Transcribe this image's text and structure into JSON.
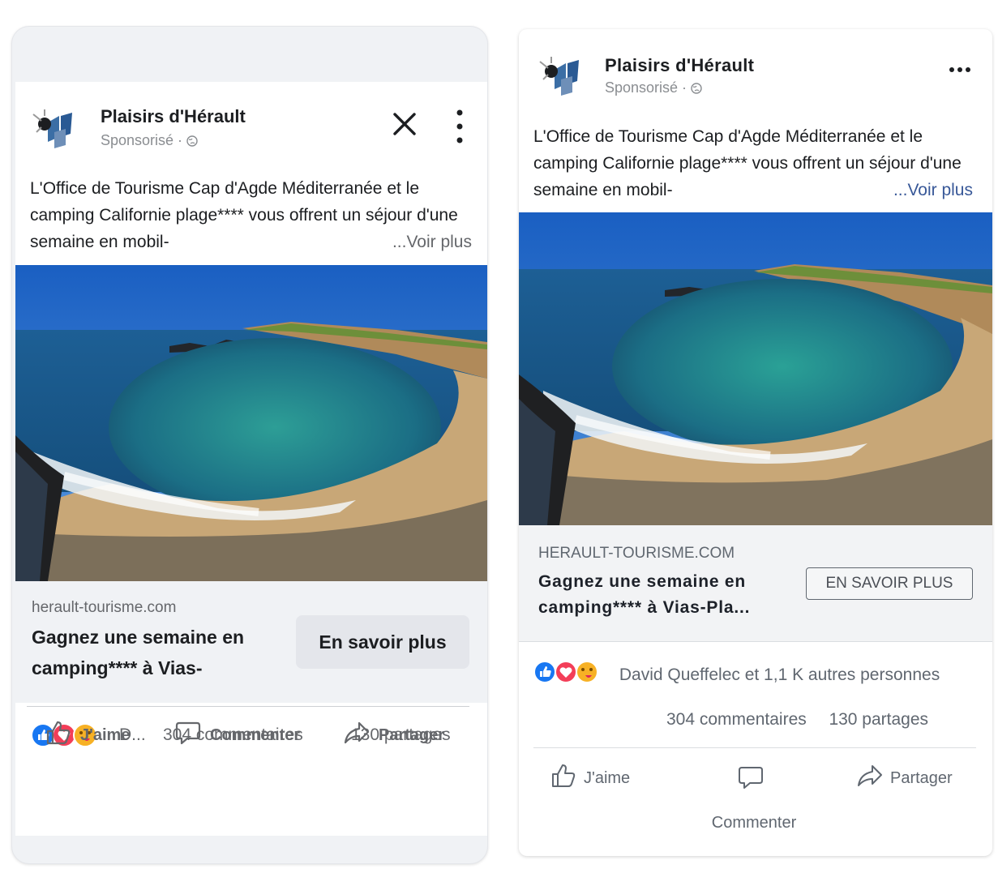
{
  "mobile_preview": {
    "page_name": "Plaisirs d'Hérault",
    "sponsored": "Sponsorisé · ",
    "body_text": "L'Office de Tourisme Cap d'Agde Méditerranée et le camping Californie plage**** vous offrent un séjour d'une semaine en mobil-",
    "see_more": "...Voir plus",
    "link_domain": "herault-tourisme.com",
    "headline": "Gagnez une semaine en camping**** à Vias-",
    "cta": "En savoir plus",
    "reaction_names": "D...",
    "comments": "304 commentaires",
    "shares": "130 partages",
    "actions": {
      "like": "J'aime",
      "comment": "Commenter",
      "share": "Partager"
    }
  },
  "desktop_preview": {
    "page_name": "Plaisirs d'Hérault",
    "sponsored": "Sponsorisé · ",
    "body_text": "L'Office de Tourisme Cap d'Agde Méditerranée et le camping Californie plage**** vous offrent un séjour d'une semaine en mobil-",
    "see_more": "...Voir plus",
    "link_domain": "HERAULT-TOURISME.COM",
    "headline": "Gagnez une semaine en camping**** à Vias-Pla...",
    "cta": "EN SAVOIR PLUS",
    "reactions": "David Queffelec et 1,1 K autres personnes",
    "comments": "304 commentaires",
    "shares": "130 partages",
    "actions": {
      "like": "J'aime",
      "comment": "Commenter",
      "share": "Partager"
    }
  },
  "colors": {
    "like_blue": "#1877f2",
    "love_red": "#f33e58",
    "care_yellow": "#f7b125",
    "link_blue": "#385898"
  },
  "icons": [
    "close-icon",
    "vertical-dots-icon",
    "horizontal-dots-icon",
    "globe-icon",
    "like-icon",
    "love-icon",
    "care-icon",
    "thumbs-up-icon",
    "comment-icon",
    "share-icon"
  ]
}
